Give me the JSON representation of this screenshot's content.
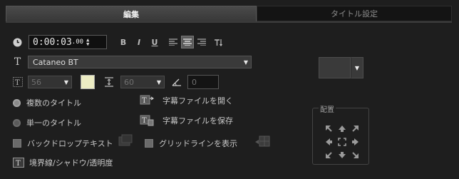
{
  "tabs": [
    {
      "label": "編集",
      "active": true
    },
    {
      "label": "タイトル設定",
      "active": false
    }
  ],
  "timecode": {
    "main": "0:00:03",
    "frames": "00"
  },
  "format_buttons": [
    "B",
    "I",
    "U"
  ],
  "alignment_active": "center",
  "font": {
    "name": "Cataneo BT"
  },
  "font_size": "56",
  "line_spacing": "60",
  "angle": "0",
  "swatch_color": "#ececc4",
  "title_mode": [
    {
      "label": "複数のタイトル",
      "selected": true
    },
    {
      "label": "単一のタイトル",
      "selected": false
    }
  ],
  "backdrop_label": "バックドロップテキスト",
  "open_subtitle_label": "字幕ファイルを開く",
  "save_subtitle_label": "字幕ファイルを保存",
  "gridlines_label": "グリッドラインを表示",
  "border_label": "境界線/シャドウ/透明度",
  "placement": {
    "legend": "配置"
  },
  "colors": {
    "accent_bg": "#1e1e1e",
    "active_tab": "#404040"
  }
}
